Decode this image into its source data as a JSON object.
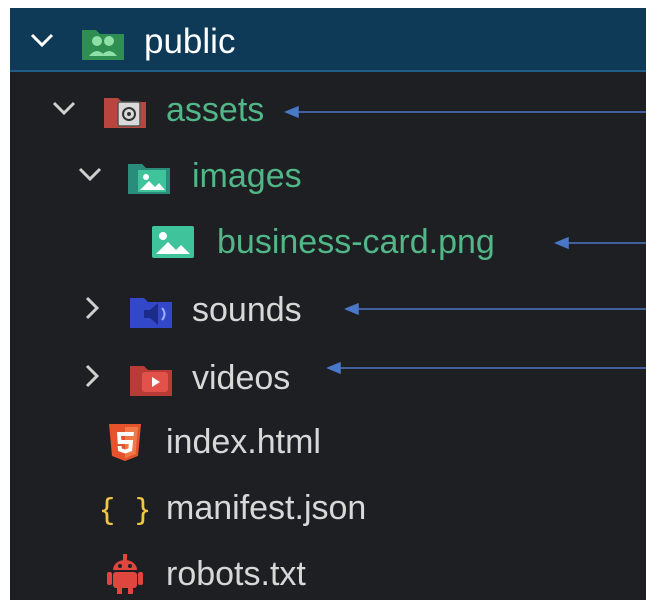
{
  "tree": {
    "root": {
      "label": "public",
      "icon": "folder-public-icon",
      "expanded": true
    },
    "items": [
      {
        "label": "assets",
        "icon": "folder-assets-icon",
        "expanded": true,
        "highlighted": true
      },
      {
        "label": "images",
        "icon": "folder-images-icon",
        "expanded": true,
        "highlighted": true
      },
      {
        "label": "business-card.png",
        "icon": "image-file-icon",
        "highlighted": true
      },
      {
        "label": "sounds",
        "icon": "folder-sounds-icon",
        "expanded": false
      },
      {
        "label": "videos",
        "icon": "folder-videos-icon",
        "expanded": false
      },
      {
        "label": "index.html",
        "icon": "html5-icon"
      },
      {
        "label": "manifest.json",
        "icon": "json-braces-icon"
      },
      {
        "label": "robots.txt",
        "icon": "robot-icon"
      }
    ]
  },
  "colors": {
    "background": "#1e1f22",
    "header_band": "#0f3a57",
    "highlight_text": "#52b788",
    "default_text": "#d8d8d8",
    "arrow": "#4a78c8"
  }
}
